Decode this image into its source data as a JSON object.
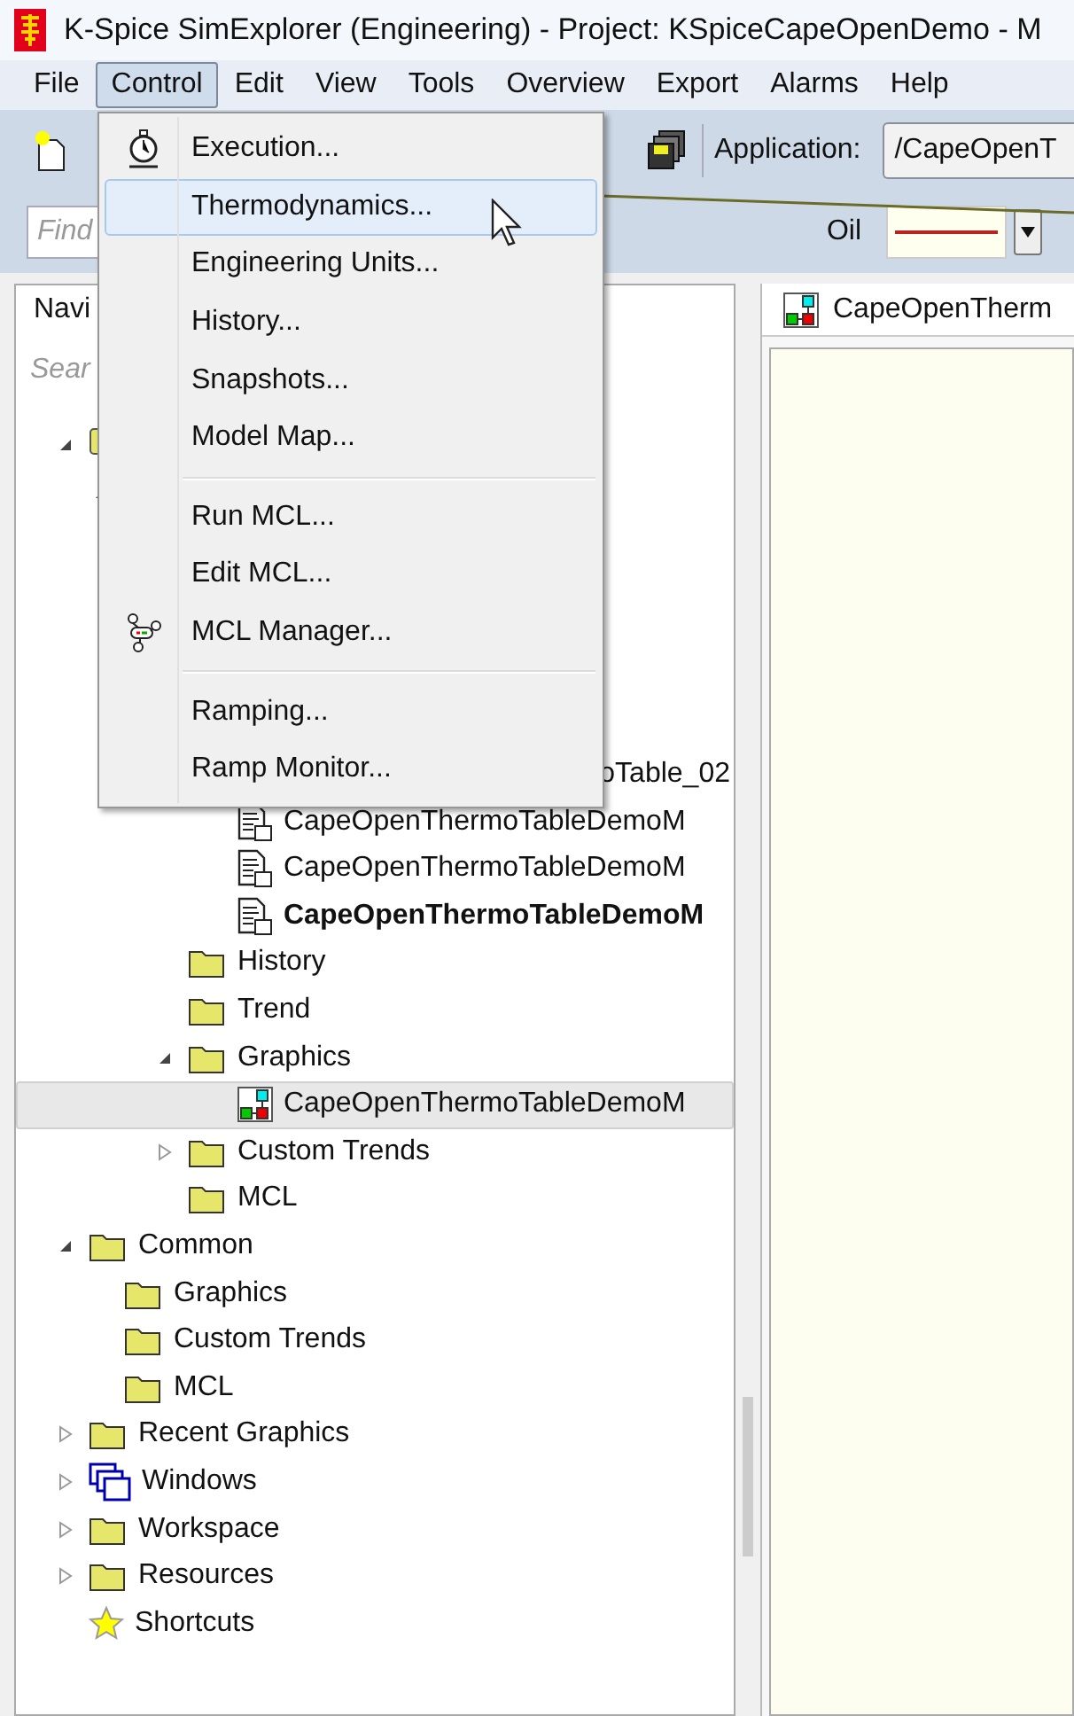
{
  "window": {
    "title": "K-Spice SimExplorer (Engineering) - Project: KSpiceCapeOpenDemo - M"
  },
  "menu_bar": [
    {
      "label": "File",
      "selected": false
    },
    {
      "label": "Control",
      "selected": true
    },
    {
      "label": "Edit",
      "selected": false
    },
    {
      "label": "View",
      "selected": false
    },
    {
      "label": "Tools",
      "selected": false
    },
    {
      "label": "Overview",
      "selected": false
    },
    {
      "label": "Export",
      "selected": false
    },
    {
      "label": "Alarms",
      "selected": false
    },
    {
      "label": "Help",
      "selected": false
    }
  ],
  "toolbar": {
    "application_label": "Application:",
    "application_value": "/CapeOpenT",
    "find_placeholder": "Find",
    "stream_label": "Oil"
  },
  "control_menu": [
    {
      "kind": "stopwatch",
      "label": "Execution...",
      "selected": false
    },
    {
      "kind": "item",
      "label": "Thermodynamics...",
      "selected": true
    },
    {
      "kind": "item",
      "label": "Engineering Units...",
      "selected": false
    },
    {
      "kind": "item",
      "label": "History...",
      "selected": false
    },
    {
      "kind": "item",
      "label": "Snapshots...",
      "selected": false
    },
    {
      "kind": "item",
      "label": "Model Map...",
      "selected": false
    },
    {
      "kind": "separator"
    },
    {
      "kind": "item",
      "label": "Run MCL...",
      "selected": false
    },
    {
      "kind": "item",
      "label": "Edit MCL...",
      "selected": false
    },
    {
      "kind": "network",
      "label": "MCL Manager...",
      "selected": false
    },
    {
      "kind": "separator"
    },
    {
      "kind": "item",
      "label": "Ramping...",
      "selected": false
    },
    {
      "kind": "item",
      "label": "Ramp Monitor...",
      "selected": false
    }
  ],
  "navigator": {
    "header": "Navi",
    "search_placeholder": "Sear",
    "tree": [
      {
        "kind": "project",
        "expanded": true,
        "children": [
          {
            "kind": "hidden",
            "expanded": true,
            "children": [
              {
                "kind": "hidden",
                "children": [
                  {
                    "kind": "clipped",
                    "label": "oTable_02"
                  },
                  {
                    "kind": "document",
                    "label": "CapeOpenThermoTableDemoM",
                    "bold": false
                  },
                  {
                    "kind": "document",
                    "label": "CapeOpenThermoTableDemoM",
                    "bold": false
                  },
                  {
                    "kind": "document",
                    "label": "CapeOpenThermoTableDemoM",
                    "bold": true
                  }
                ]
              },
              {
                "kind": "folder",
                "label": "History"
              },
              {
                "kind": "folder",
                "label": "Trend"
              },
              {
                "kind": "folder",
                "label": "Graphics",
                "expanded": true,
                "children": [
                  {
                    "kind": "graphic",
                    "label": "CapeOpenThermoTableDemoM",
                    "selected": true
                  }
                ]
              },
              {
                "kind": "folder",
                "label": "Custom Trends",
                "expanded": false
              },
              {
                "kind": "folder",
                "label": "MCL"
              }
            ]
          }
        ]
      },
      {
        "kind": "folder",
        "label": "Common",
        "expanded": true,
        "children": [
          {
            "kind": "folder",
            "label": "Graphics"
          },
          {
            "kind": "folder",
            "label": "Custom Trends"
          },
          {
            "kind": "folder",
            "label": "MCL"
          }
        ]
      },
      {
        "kind": "folder",
        "label": "Recent Graphics",
        "expanded": false
      },
      {
        "kind": "windows",
        "label": "Windows",
        "expanded": false
      },
      {
        "kind": "folder",
        "label": "Workspace",
        "expanded": false
      },
      {
        "kind": "folder",
        "label": "Resources",
        "expanded": false
      },
      {
        "kind": "star",
        "label": "Shortcuts"
      }
    ]
  },
  "document_tab": {
    "label": "CapeOpenTherm"
  }
}
